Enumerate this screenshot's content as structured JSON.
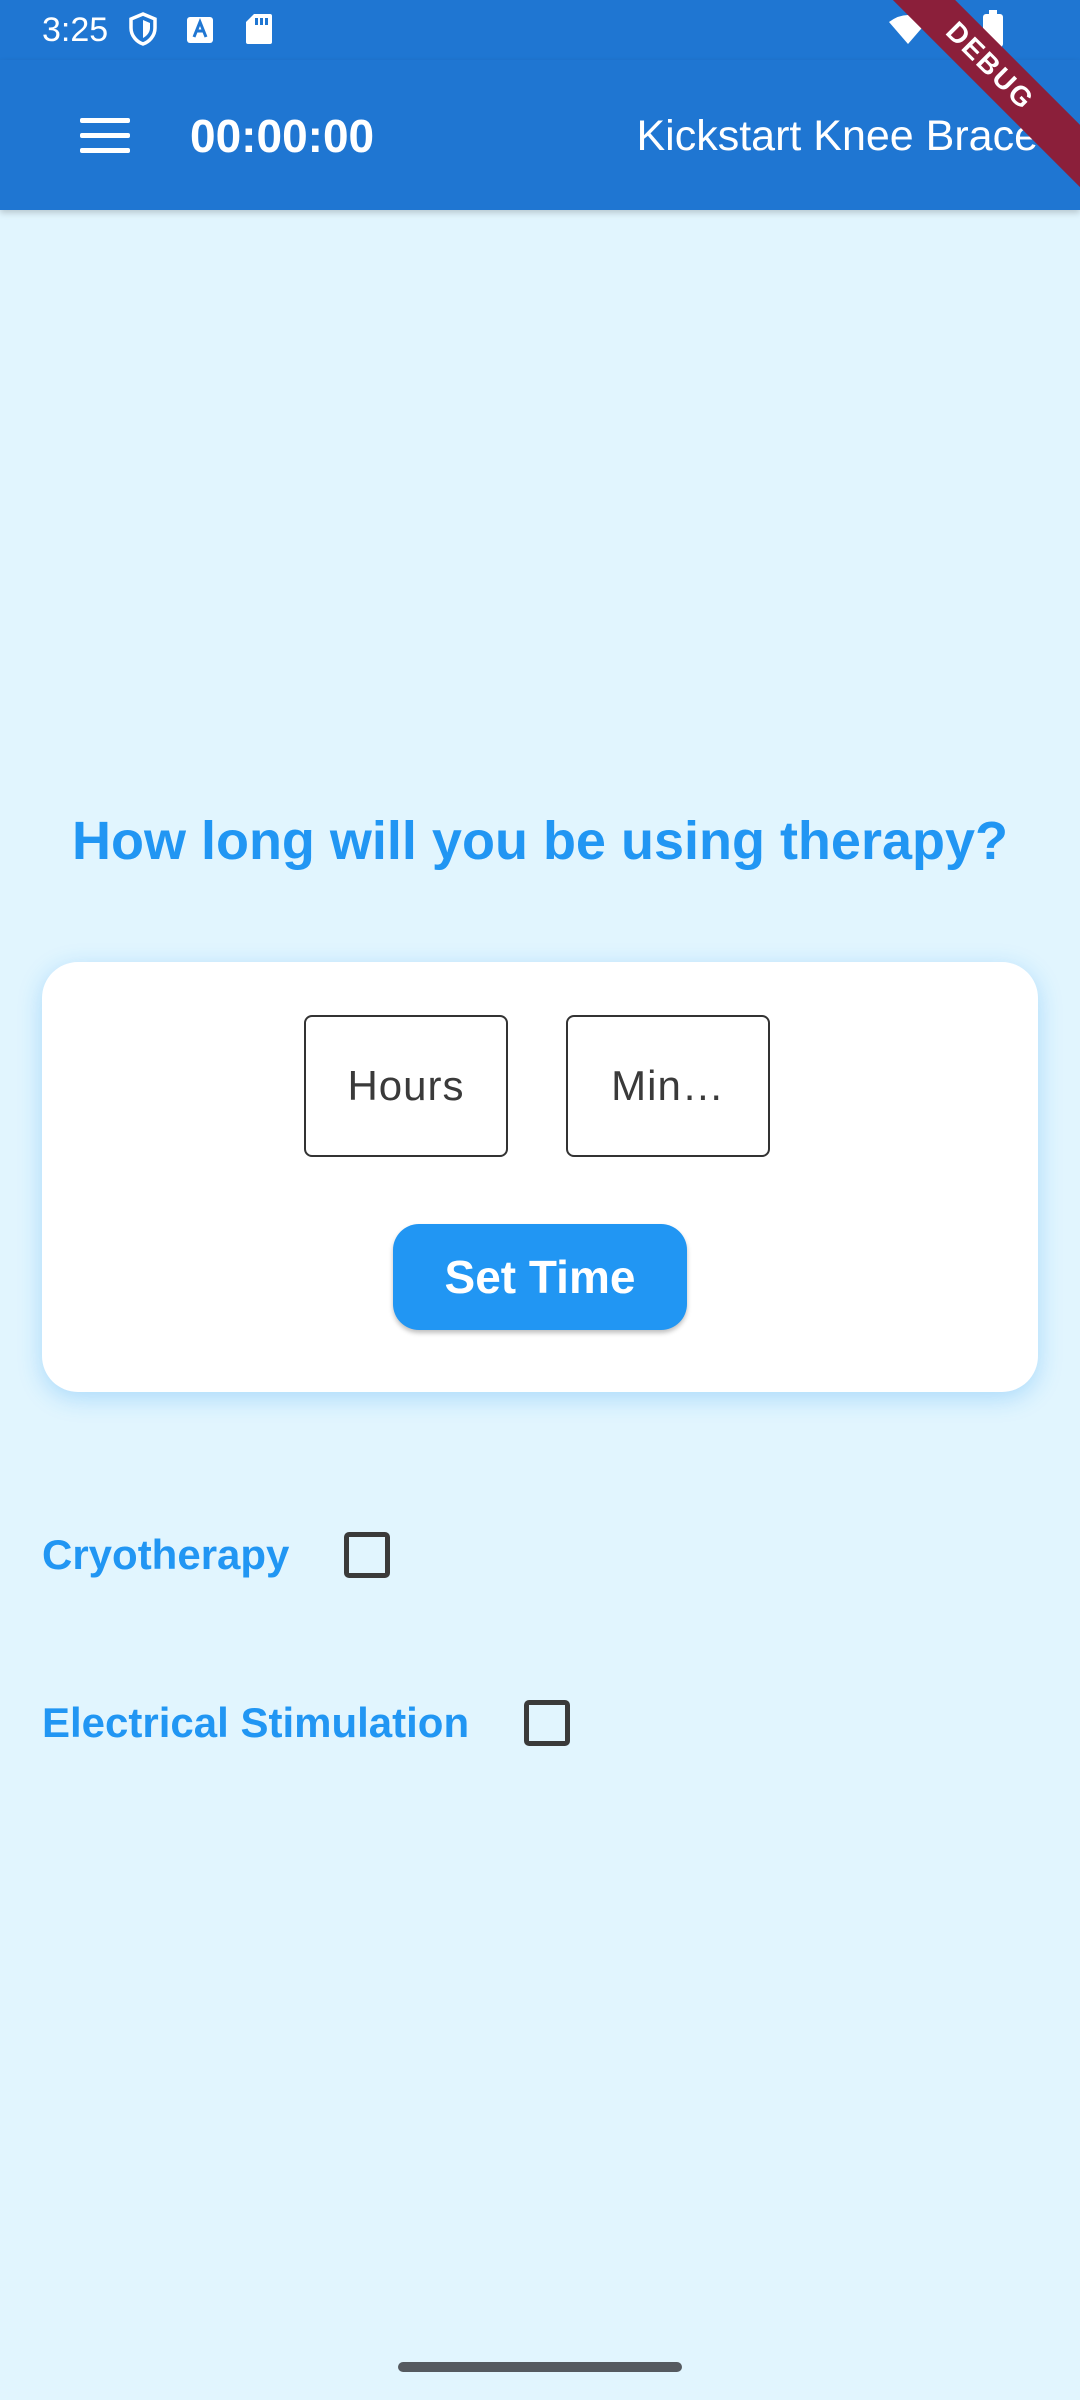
{
  "status_bar": {
    "time": "3:25",
    "left_icons": [
      "shield-icon",
      "a-badge-icon",
      "sd-card-icon"
    ],
    "right_icons": [
      "wifi-icon",
      "cellular-signal-icon",
      "battery-icon"
    ]
  },
  "app_bar": {
    "timer": "00:00:00",
    "title": "Kickstart Knee Brace",
    "menu_icon": "hamburger-menu-icon",
    "debug_label": "DEBUG"
  },
  "main": {
    "question": "How long will you be using therapy?",
    "hours_placeholder": "Hours",
    "minutes_placeholder": "Min…",
    "set_time_label": "Set Time"
  },
  "options": [
    {
      "label": "Cryotherapy",
      "checked": false
    },
    {
      "label": "Electrical Stimulation",
      "checked": false
    }
  ],
  "colors": {
    "app_bar": "#1f76d2",
    "accent": "#2196f3",
    "background": "#e1f5fe",
    "debug_banner": "#8b1f3a"
  }
}
